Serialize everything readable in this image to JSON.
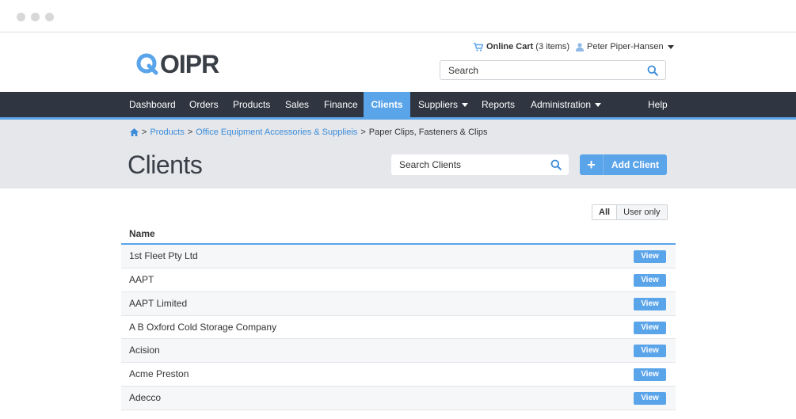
{
  "header": {
    "logo_text": "OIPR",
    "cart_label": "Online Cart",
    "cart_count": "(3 items)",
    "user_name": "Peter Piper-Hansen",
    "search_placeholder": "Search"
  },
  "nav": {
    "items": [
      {
        "label": "Dashboard",
        "active": false,
        "dropdown": false
      },
      {
        "label": "Orders",
        "active": false,
        "dropdown": false
      },
      {
        "label": "Products",
        "active": false,
        "dropdown": false
      },
      {
        "label": "Sales",
        "active": false,
        "dropdown": false
      },
      {
        "label": "Finance",
        "active": false,
        "dropdown": false
      },
      {
        "label": "Clients",
        "active": true,
        "dropdown": false
      },
      {
        "label": "Suppliers",
        "active": false,
        "dropdown": true
      },
      {
        "label": "Reports",
        "active": false,
        "dropdown": false
      },
      {
        "label": "Administration",
        "active": false,
        "dropdown": true
      },
      {
        "label": "Help",
        "active": false,
        "dropdown": false
      }
    ]
  },
  "breadcrumb": {
    "links": [
      "Products",
      "Office Equipment Accessories & Supplieis"
    ],
    "current": "Paper Clips, Fasteners & Clips"
  },
  "page": {
    "title": "Clients",
    "search_placeholder": "Search Clients",
    "add_button": "Add Client"
  },
  "filter": {
    "all_label": "All",
    "user_only_label": "User only",
    "selected": "All"
  },
  "table": {
    "column_header": "Name",
    "action_label": "View",
    "rows": [
      "1st Fleet Pty Ltd",
      "AAPT",
      "AAPT Limited",
      "A B Oxford Cold Storage Company",
      "Acision",
      "Acme Preston",
      "Adecco"
    ]
  },
  "colors": {
    "accent": "#5aa4ea",
    "nav_background": "#2f3641",
    "band_background": "#e5e7eb",
    "link": "#3b8bd8"
  }
}
